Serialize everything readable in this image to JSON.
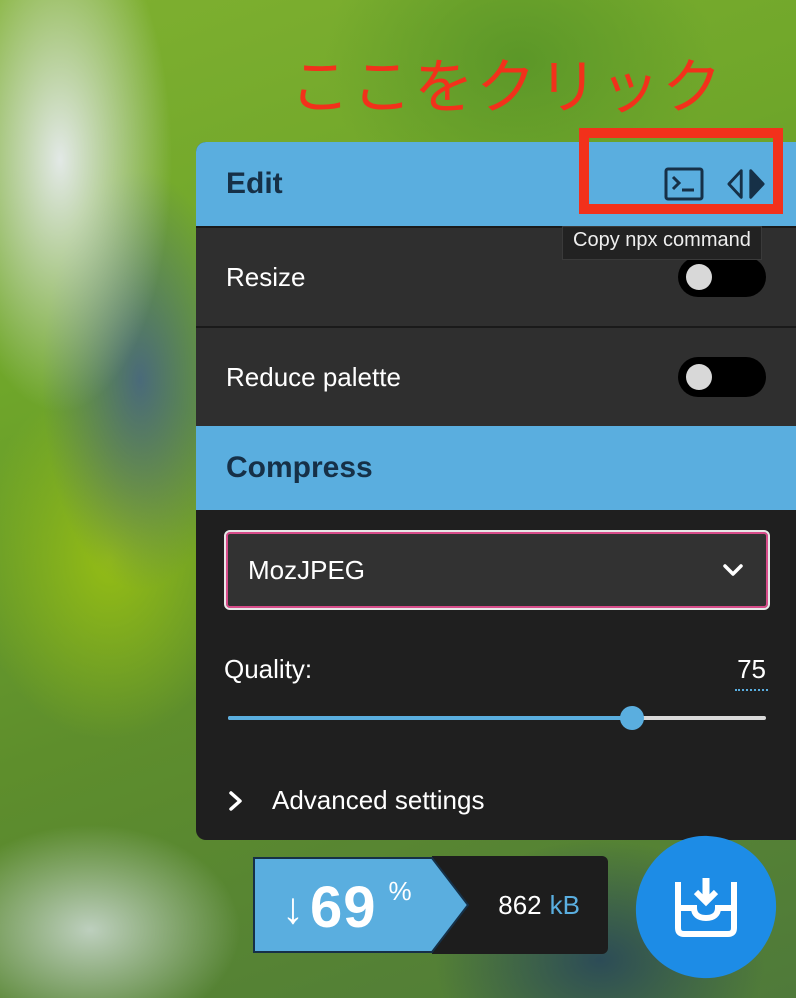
{
  "annotation": {
    "text": "ここをクリック"
  },
  "colors": {
    "accent": "#5aaedf",
    "annotation": "#f2311b",
    "select_border": "#d74c8a"
  },
  "edit": {
    "title": "Edit",
    "terminal_icon": "terminal-icon",
    "compare_icon": "compare-arrows-icon",
    "tooltip": "Copy npx command",
    "options": [
      {
        "label": "Resize",
        "enabled": false
      },
      {
        "label": "Reduce palette",
        "enabled": false
      }
    ]
  },
  "compress": {
    "title": "Compress",
    "codec": "MozJPEG",
    "quality_label": "Quality:",
    "quality_value": "75",
    "quality_fraction": 0.75,
    "advanced_label": "Advanced settings"
  },
  "results": {
    "arrow": "↓",
    "percent": "69",
    "percent_sign": "%",
    "size_value": "862",
    "size_unit": "kB",
    "download_icon": "download-icon"
  }
}
